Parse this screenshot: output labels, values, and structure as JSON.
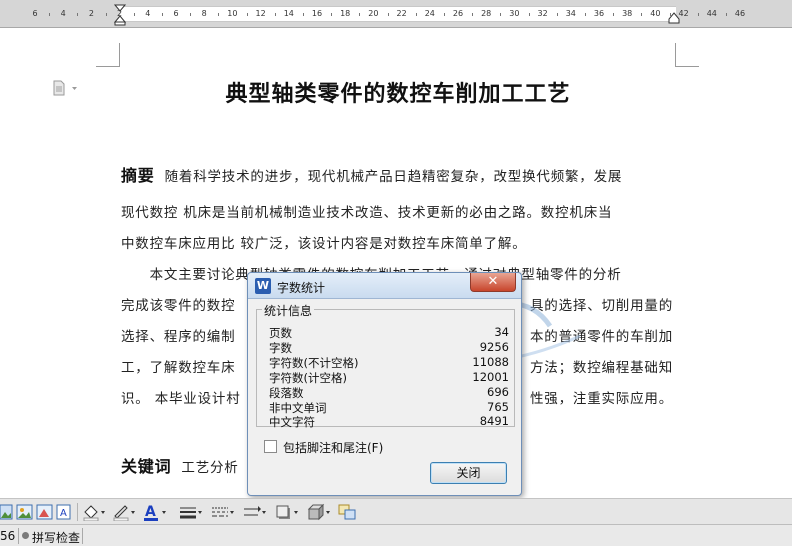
{
  "ruler": {
    "labels": [
      "6",
      "4",
      "2",
      "2",
      "4",
      "6",
      "8",
      "10",
      "12",
      "14",
      "16",
      "18",
      "20",
      "22",
      "24",
      "26",
      "28",
      "30",
      "32",
      "34",
      "36",
      "38",
      "40",
      "42",
      "44",
      "46"
    ]
  },
  "document": {
    "title": "典型轴类零件的数控车削加工工艺",
    "paragraphs": [
      {
        "keyword": "摘要",
        "text": "随着科学技术的进步，现代机械产品日趋精密复杂，改型换代频繁，发展"
      },
      {
        "text": "现代数控 机床是当前机械制造业技术改造、技术更新的必由之路。数控机床当"
      },
      {
        "text": "中数控车床应用比 较广泛，该设计内容是对数控车床简单了解。"
      },
      {
        "text": "　　本文主要讨论典型轴类零件的数控车削加工工艺，通过对典型轴零件的分析"
      },
      {
        "text": "完成该零件的数控"
      },
      {
        "text": "具的选择、切削用量的",
        "right": true
      },
      {
        "text": "选择、程序的编制"
      },
      {
        "text": "本的普通零件的车削加",
        "right": true
      },
      {
        "text": "工，了解数控车床"
      },
      {
        "text": "方法；数控编程基础知",
        "right": true
      },
      {
        "text": "识。 本毕业设计村"
      },
      {
        "text": "性强，注重实际应用。",
        "right": true
      },
      {
        "keyword": "关键词",
        "text": "工艺分析"
      }
    ]
  },
  "dialog": {
    "title": "字数统计",
    "close_glyph": "✕",
    "group_label": "统计信息",
    "stats": [
      {
        "label": "页数",
        "value": "34"
      },
      {
        "label": "字数",
        "value": "9256"
      },
      {
        "label": "字符数(不计空格)",
        "value": "11088"
      },
      {
        "label": "字符数(计空格)",
        "value": "12001"
      },
      {
        "label": "段落数",
        "value": "696"
      },
      {
        "label": "非中文单词",
        "value": "765"
      },
      {
        "label": "中文字符",
        "value": "8491"
      }
    ],
    "checkbox_label": "包括脚注和尾注(F)",
    "checkbox_checked": false,
    "button_label": "关闭"
  },
  "status": {
    "page_fragment": "56",
    "spell_check": "拼写检查"
  },
  "colors": {
    "ruler_bg": "#d6d6d6",
    "dialog_close": "#c8452c",
    "button_border": "#3c7fb1",
    "font_color_a": "#1b3fbf"
  },
  "icons": {
    "toolbar": [
      "insert-image-icon",
      "insert-picture-icon",
      "text-box-icon",
      "fill-color-icon",
      "line-color-icon",
      "font-color-icon",
      "line-style-icon",
      "dash-style-icon",
      "arrow-style-icon",
      "shadow-icon",
      "3d-effect-icon",
      "select-objects-icon"
    ]
  }
}
